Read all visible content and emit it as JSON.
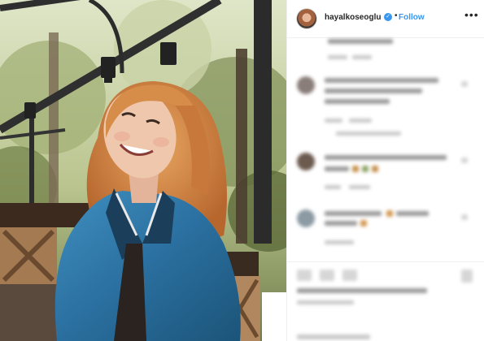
{
  "post": {
    "username": "hayalkoseoglu",
    "follow_label": "Follow",
    "separator": "•",
    "more_label": "•••",
    "verified_glyph": "✓"
  },
  "icons": [
    "verified-badge-icon",
    "more-options-icon",
    "like-icon",
    "comment-icon",
    "share-icon",
    "save-icon"
  ],
  "colors": {
    "accent": "#3897f0",
    "text": "#262626",
    "border": "#efefef"
  }
}
